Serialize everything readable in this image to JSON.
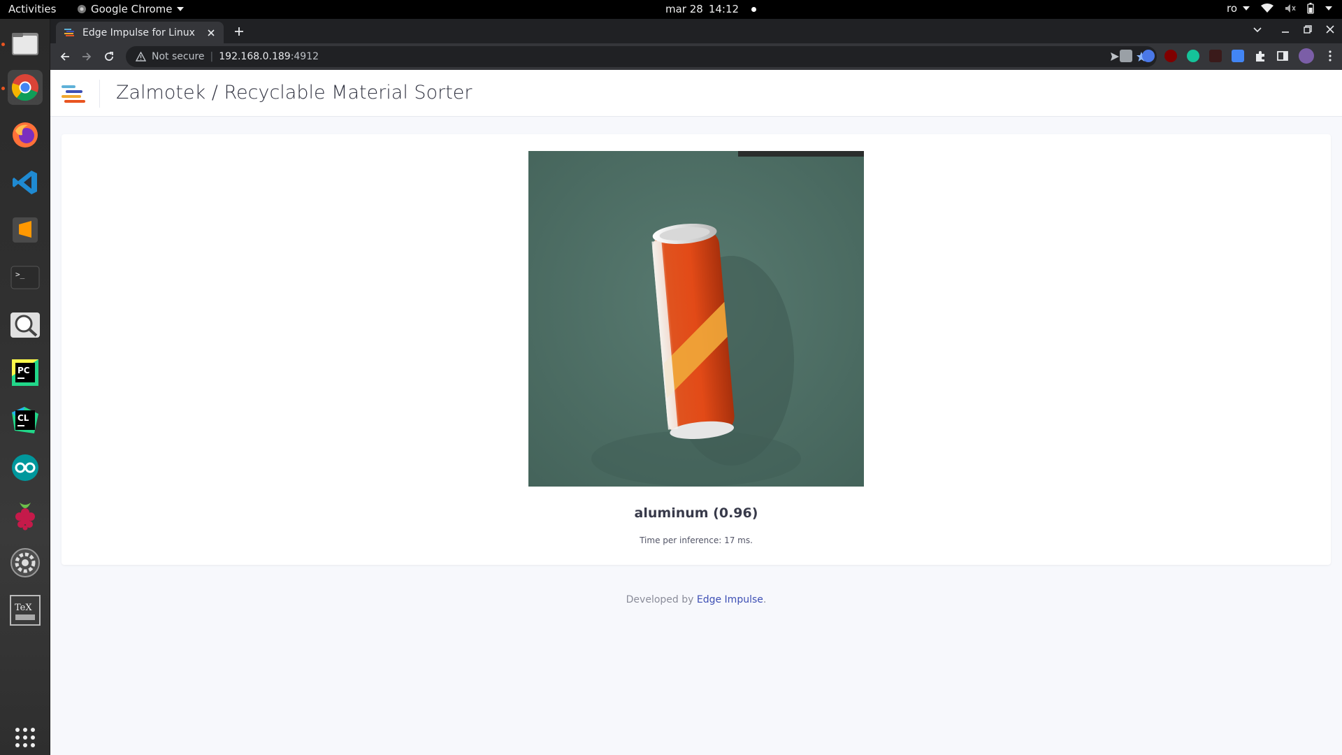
{
  "topbar": {
    "activities": "Activities",
    "app_name": "Google Chrome",
    "date": "mar 28",
    "time": "14:12",
    "keyboard_layout": "ro"
  },
  "dock": {
    "items": [
      {
        "name": "files-icon"
      },
      {
        "name": "chrome-icon"
      },
      {
        "name": "firefox-icon"
      },
      {
        "name": "vscode-icon"
      },
      {
        "name": "sublime-text-icon"
      },
      {
        "name": "terminal-icon"
      },
      {
        "name": "magnifier-icon"
      },
      {
        "name": "pycharm-icon"
      },
      {
        "name": "clion-icon"
      },
      {
        "name": "arduino-icon"
      },
      {
        "name": "raspberry-pi-icon"
      },
      {
        "name": "settings-icon"
      },
      {
        "name": "texmaker-icon"
      }
    ],
    "pycharm_label": "PC",
    "clion_label": "CL",
    "texmaker_label": "TeX"
  },
  "browser": {
    "tab_title": "Edge Impulse for Linux",
    "security_label": "Not secure",
    "url_host": "192.168.0.189",
    "url_port": ":4912"
  },
  "page": {
    "header_title": "Zalmotek / Recyclable Material Sorter",
    "classification_result": "aluminum (0.96)",
    "timing_text": "Time per inference: 17 ms.",
    "footer_prefix": "Developed by ",
    "footer_link": "Edge Impulse",
    "footer_suffix": "."
  },
  "colors": {
    "accent_link": "#3d4fb4",
    "ubuntu_orange": "#e95420",
    "camera_background": "#4e6e64",
    "can_red": "#d9401a",
    "can_band": "#f0a830"
  }
}
